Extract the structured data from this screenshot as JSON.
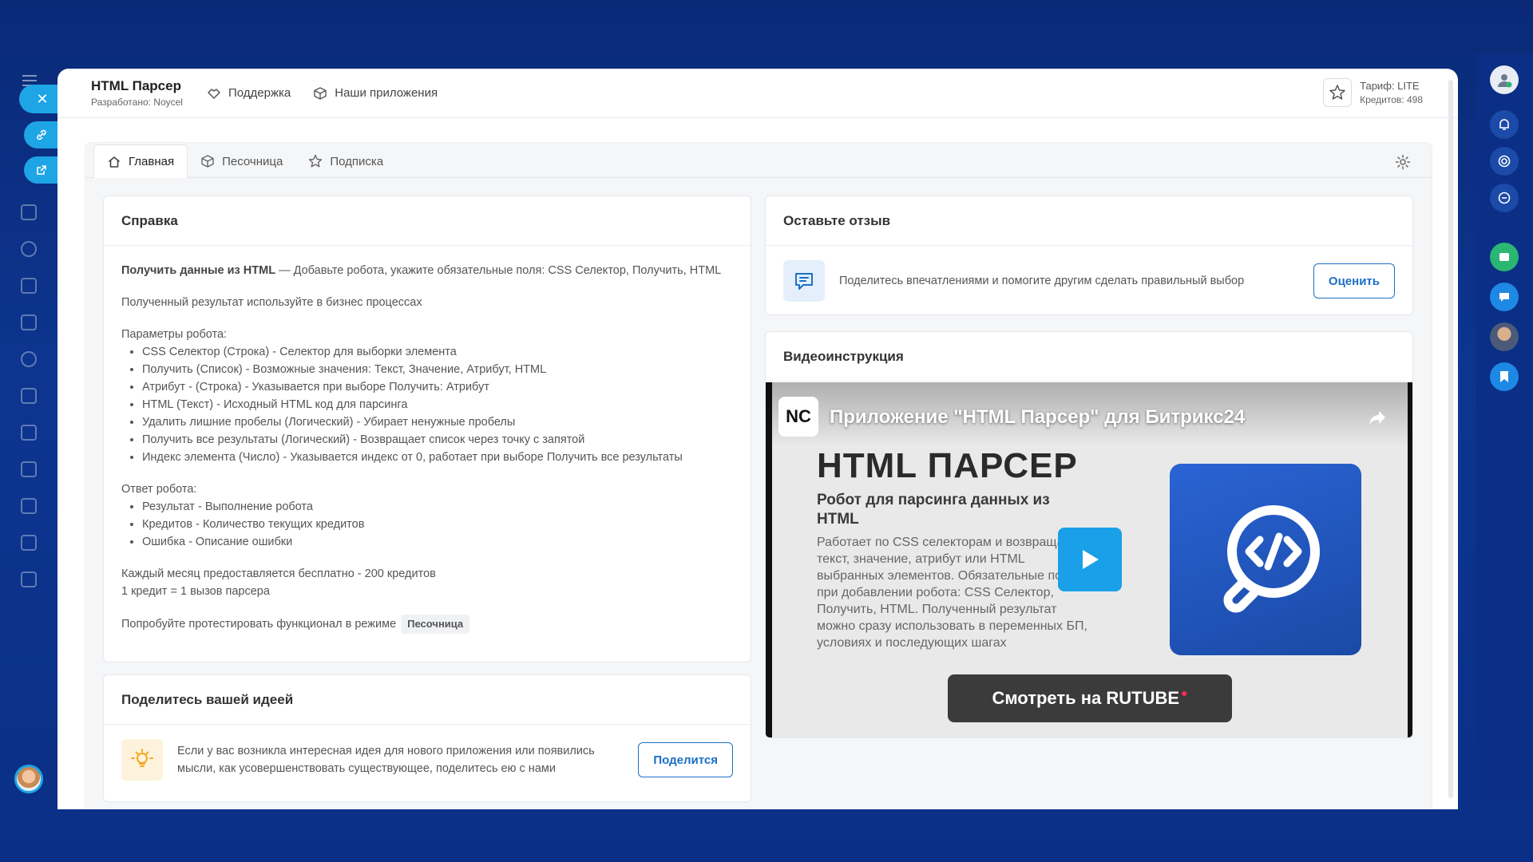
{
  "app": {
    "title": "HTML Парсер",
    "developer": "Разработано: Noycel"
  },
  "topnav": {
    "support": "Поддержка",
    "apps": "Наши приложения"
  },
  "tariff": {
    "plan": "Тариф: LITE",
    "credits": "Кредитов: 498"
  },
  "tabs": [
    {
      "label": "Главная",
      "icon": "home-icon",
      "active": true
    },
    {
      "label": "Песочница",
      "icon": "cube-icon",
      "active": false
    },
    {
      "label": "Подписка",
      "icon": "star-icon",
      "active": false
    }
  ],
  "help": {
    "title": "Справка",
    "intro_bold": "Получить данные из HTML",
    "intro_rest": " — Добавьте робота, укажите обязательные поля: CSS Селектор, Получить, HTML",
    "usage": "Полученный результат используйте в бизнес процессах",
    "params_title": "Параметры робота:",
    "params": [
      "CSS Селектор (Строка) - Селектор для выборки элемента",
      "Получить (Список) - Возможные значения: Текст, Значение, Атрибут, HTML",
      "Атрибут - (Строка) - Указывается при выборе Получить: Атрибут",
      "HTML (Текст) - Исходный HTML код для парсинга",
      "Удалить лишние пробелы (Логический) - Убирает ненужные пробелы",
      "Получить все результаты (Логический) - Возвращает список через точку с запятой",
      "Индекс элемента (Число) - Указывается индекс от 0, работает при выборе Получить все результаты"
    ],
    "response_title": "Ответ робота:",
    "response": [
      "Результат - Выполнение робота",
      "Кредитов - Количество текущих кредитов",
      "Ошибка - Описание ошибки"
    ],
    "free_line": "Каждый месяц предоставляется бесплатно - 200 кредитов",
    "credit_line": "1 кредит = 1 вызов парсера",
    "try_text": "Попробуйте протестировать функционал в режиме",
    "try_chip": "Песочница"
  },
  "idea": {
    "title": "Поделитесь вашей идеей",
    "text": "Если у вас возникла интересная идея для нового приложения или появились мысли, как усовершенствовать существующее, поделитесь ею с нами",
    "button": "Поделится"
  },
  "review": {
    "title": "Оставьте отзыв",
    "text": "Поделитесь впечатлениями и помогите другим сделать правильный выбор",
    "button": "Оценить"
  },
  "video": {
    "section_title": "Видеоинструкция",
    "badge": "NC",
    "title": "Приложение \"HTML Парсер\" для Битрикс24",
    "heading": "HTML ПАРСЕР",
    "subheading": "Робот для парсинга данных из HTML",
    "description": "Работает по CSS селекторам и возвращает текст, значение, атрибут или HTML выбранных элементов. Обязательные поля при добавлении робота: CSS Селектор, Получить, HTML. Полученный результат можно сразу использовать в переменных БП, условиях и последующих шагах",
    "watch": "Смотреть на RUTUBE"
  },
  "colors": {
    "accent": "#1d6fc4",
    "background": "#0d3590",
    "play": "#1aa0e8"
  }
}
